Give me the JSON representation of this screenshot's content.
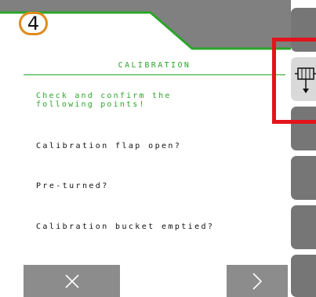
{
  "header": {
    "step_number": "4",
    "accent_color": "#2aa52a",
    "badge_color": "#e08a1e"
  },
  "page": {
    "title": "CALIBRATION",
    "instruction": "Check and confirm the\nfollowing points!",
    "items": [
      {
        "label": "Calibration flap open?"
      },
      {
        "label": "Pre-turned?"
      },
      {
        "label": "Calibration bucket emptied?"
      }
    ]
  },
  "footer": {
    "cancel_icon": "close-icon",
    "next_icon": "chevron-right-icon"
  },
  "sidebar": {
    "buttons": [
      {
        "icon": "none"
      },
      {
        "icon": "calibration-icon",
        "highlighted": true
      },
      {
        "icon": "none"
      },
      {
        "icon": "none"
      },
      {
        "icon": "none"
      },
      {
        "icon": "none"
      }
    ],
    "highlight_color": "#e3141b"
  }
}
